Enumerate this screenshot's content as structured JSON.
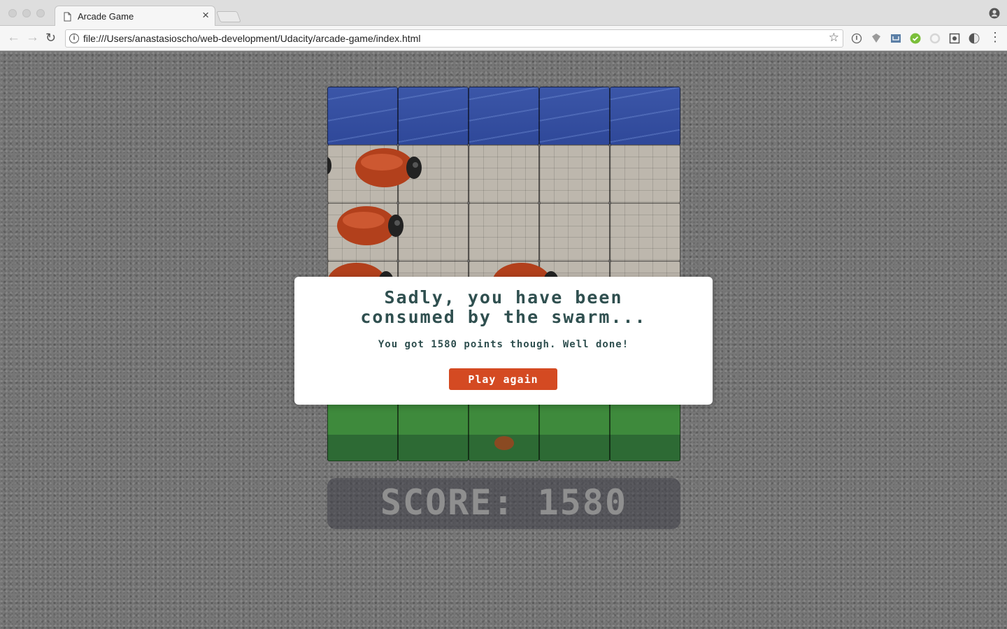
{
  "browser": {
    "tab_title": "Arcade Game",
    "url": "file:///Users/anastasioscho/web-development/Udacity/arcade-game/index.html",
    "extensions": [
      "info-icon",
      "shield-icon",
      "mail-icon",
      "check-icon",
      "spinner-icon",
      "screenshot-icon",
      "contrast-icon"
    ]
  },
  "game": {
    "rows": [
      "water",
      "stone",
      "stone",
      "stone",
      "grass",
      "grass"
    ],
    "columns": 5,
    "score_label": "SCORE:",
    "score_value": "1580"
  },
  "modal": {
    "title_line1": "Sadly, you have been",
    "title_line2": "consumed by the swarm...",
    "subtitle": "You got 1580 points though. Well done!",
    "button_label": "Play again"
  },
  "colors": {
    "accent": "#d44a22",
    "text_dark": "#2f4f4f",
    "water": "#3b56a8",
    "grass": "#3e8a3c"
  }
}
